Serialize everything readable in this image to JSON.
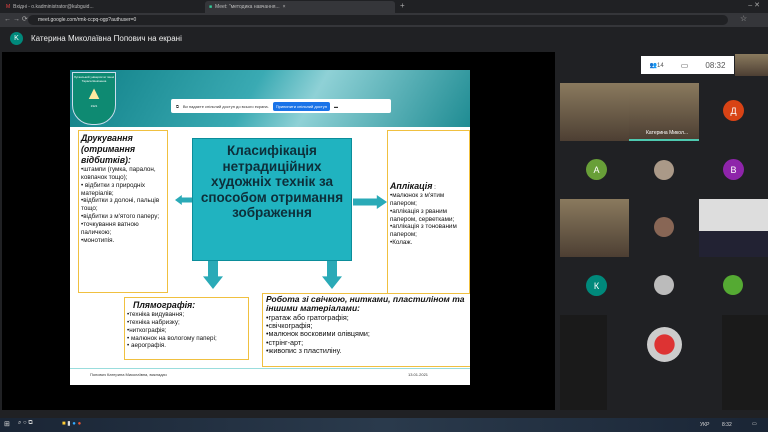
{
  "browser": {
    "tabs": [
      {
        "label": "Вхідні - o.kadministrator@kubguid..."
      },
      {
        "label": "Meet: \"методика навчання..."
      }
    ],
    "url": "meet.google.com/rmk-ccpq-ogp?authuser=0"
  },
  "meet": {
    "presenter_initial": "K",
    "presenter_label": "Катерина Миколаївна Попович на екрані",
    "time": "08:32",
    "participant_count": "14"
  },
  "share_banner": {
    "text": "Ви надаєте спільний доступ до всього екрана.",
    "stop_button": "Припинити спільний доступ"
  },
  "slide": {
    "logo_text": "Луганський університет імені Тараса Шевченка",
    "logo_year": "1921",
    "title": "Класифікація нетрадиційних художніх технік за способом отримання зображення",
    "left": {
      "heading": "Друкування (отримання відбитків):",
      "items": [
        "•штампи (гумка, паралон, ковпачок тощо);",
        "• відбитки з природніх матеріалів;",
        "•відбитки з долоні, пальців тощо;",
        "•відбитки з м'ятого паперу;",
        "•точкування ватною паличкою;",
        "•монотипія."
      ]
    },
    "right": {
      "heading": "Аплікація",
      "suffix": " :",
      "items": [
        "•малюнок з м'ятим папером;",
        "•аплікація з рваним папером, серветками;",
        "•аплікація з тонованим папером;",
        "•Колаж."
      ]
    },
    "bottom_left": {
      "heading": "Плямографія:",
      "items": [
        "•техніка видування;",
        "•техніка набризку;",
        "•ниткографія;",
        "• малюнок на вологому папері;",
        "• аерографія."
      ]
    },
    "bottom_right": {
      "heading": "Робота зі свічкою, нитками, пластиліном та іншими матеріалами:",
      "items": [
        "•гратаж або гратографія;",
        "•свічкографія;",
        "•малюнок восковими олівцями;",
        "•стрінг-арт;",
        "•живопис з пластиліну."
      ]
    },
    "footer_author": "Попович Катерина Миколаївна, викладач",
    "footer_date": "13.01.2021"
  },
  "participants": {
    "tile_name": "Катерина Микол...",
    "avatars": [
      {
        "letter": "Д",
        "color": "#d84315"
      },
      {
        "letter": "А",
        "color": "#689f38"
      },
      {
        "letter": "В",
        "color": "#8e24aa"
      },
      {
        "letter": "К",
        "color": "#00897b"
      }
    ]
  },
  "taskbar": {
    "lang": "УКР",
    "time": "8:32"
  }
}
